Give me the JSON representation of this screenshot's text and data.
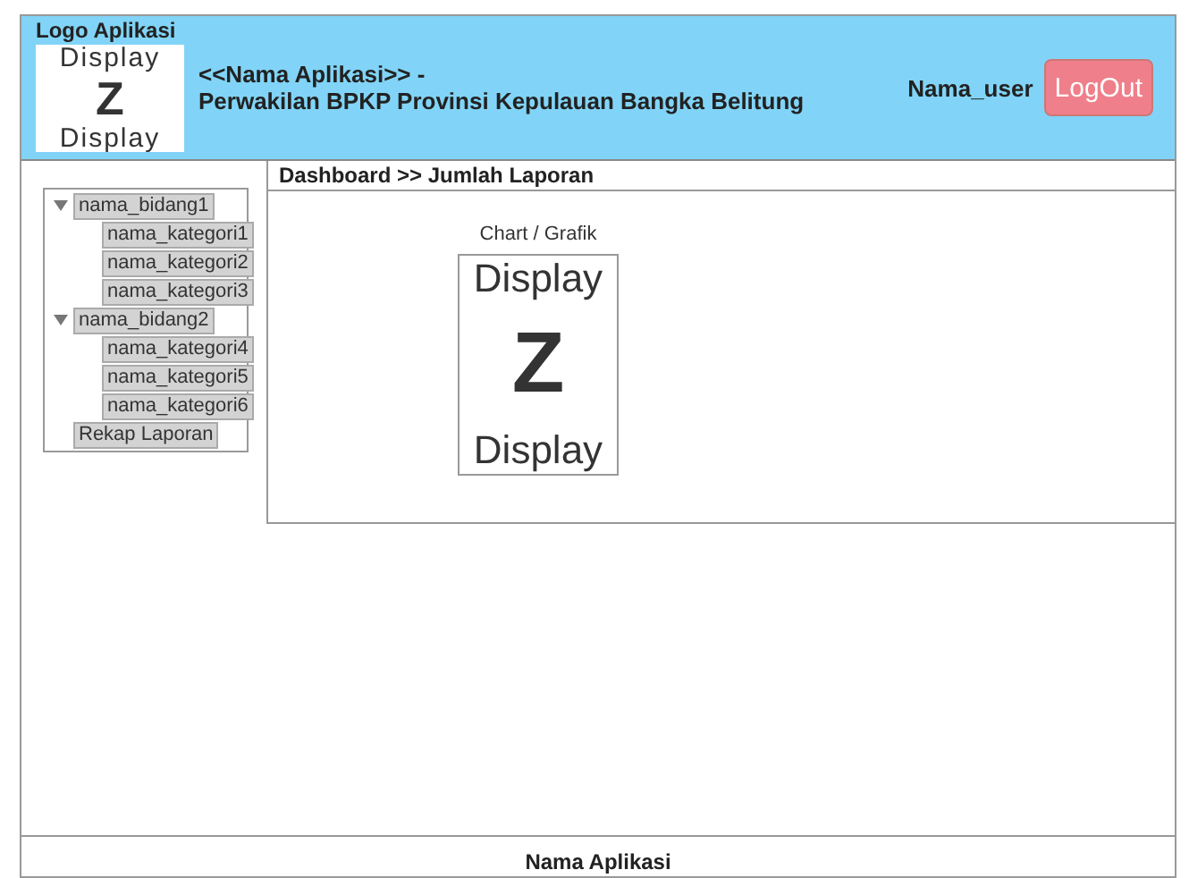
{
  "header": {
    "logo_label": "Logo Aplikasi",
    "logo_placeholder": [
      "Display",
      "Z",
      "Display"
    ],
    "title_lines": [
      "<<Nama Aplikasi>> -",
      "Perwakilan BPKP Provinsi Kepulauan Bangka Belitung"
    ],
    "user": "Nama_user",
    "logout_button": "LogOut"
  },
  "sidebar": {
    "tree": [
      {
        "label": "nama_bidang1",
        "expanded": true,
        "children": [
          {
            "label": "nama_kategori1"
          },
          {
            "label": "nama_kategori2"
          },
          {
            "label": "nama_kategori3"
          }
        ]
      },
      {
        "label": "nama_bidang2",
        "expanded": true,
        "children": [
          {
            "label": "nama_kategori4"
          },
          {
            "label": "nama_kategori5"
          },
          {
            "label": "nama_kategori6"
          }
        ]
      },
      {
        "label": "Rekap Laporan"
      }
    ]
  },
  "content": {
    "breadcrumb": "Dashboard >> Jumlah Laporan",
    "chart_label": "Chart / Grafik",
    "chart_placeholder": [
      "Display",
      "Z",
      "Display"
    ]
  },
  "footer": {
    "text": "Nama Aplikasi"
  }
}
